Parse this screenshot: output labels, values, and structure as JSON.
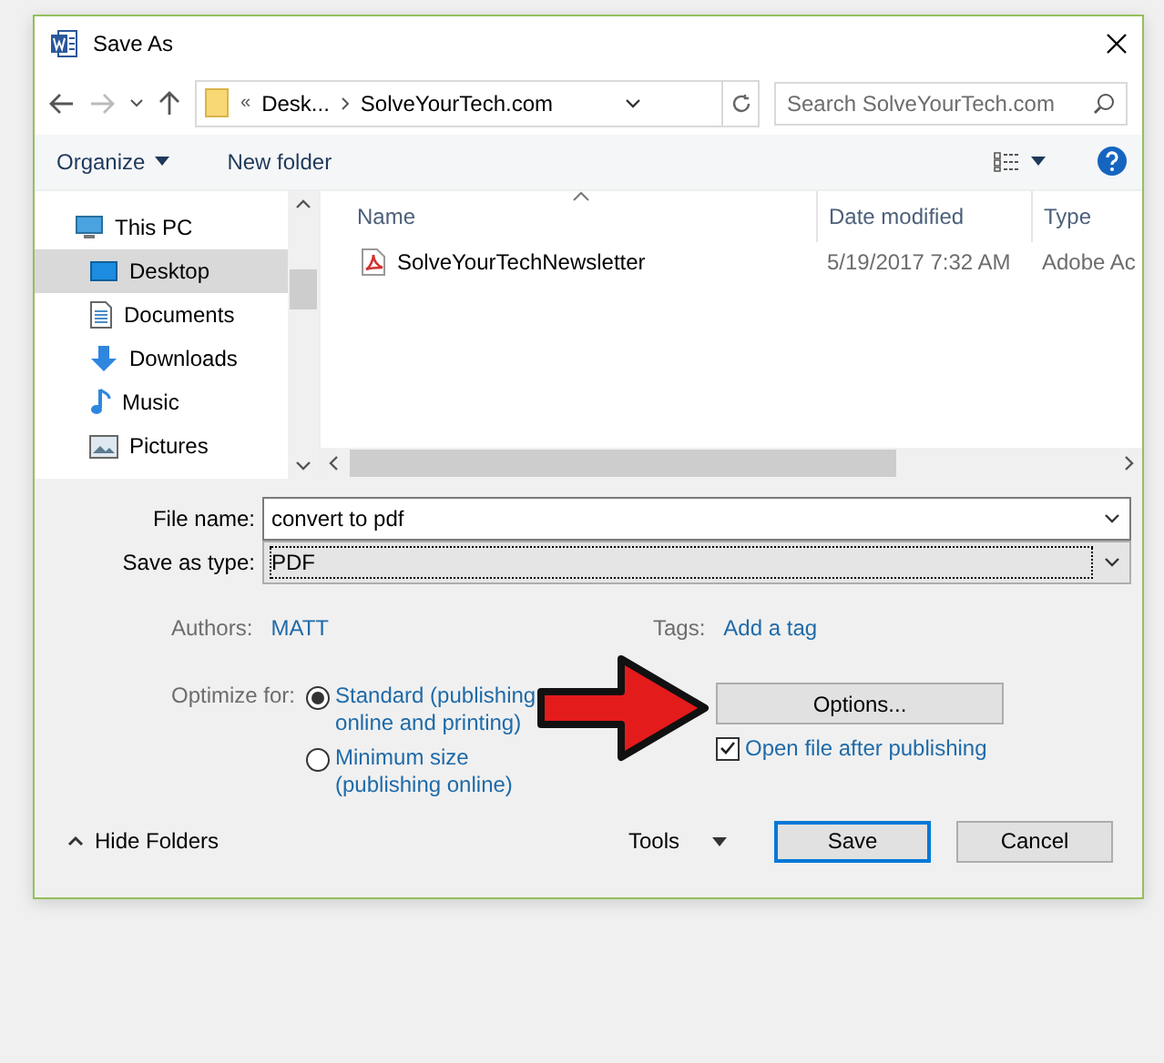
{
  "window": {
    "title": "Save As"
  },
  "address": {
    "overflow": "«",
    "crumbs": [
      "Desk...",
      "SolveYourTech.com"
    ]
  },
  "search": {
    "placeholder": "Search SolveYourTech.com"
  },
  "toolbar": {
    "organize": "Organize",
    "new_folder": "New folder"
  },
  "nav_tree": [
    {
      "label": "This PC",
      "selected": false,
      "children": [
        {
          "label": "Desktop",
          "selected": true
        },
        {
          "label": "Documents",
          "selected": false
        },
        {
          "label": "Downloads",
          "selected": false
        },
        {
          "label": "Music",
          "selected": false
        },
        {
          "label": "Pictures",
          "selected": false
        }
      ]
    }
  ],
  "columns": [
    "Name",
    "Date modified",
    "Type"
  ],
  "files": [
    {
      "name": "SolveYourTechNewsletter",
      "date": "5/19/2017 7:32 AM",
      "type": "Adobe Ac"
    }
  ],
  "file_name": {
    "label": "File name:",
    "value": "convert to pdf"
  },
  "save_type": {
    "label": "Save as type:",
    "value": "PDF"
  },
  "authors": {
    "label": "Authors:",
    "value": "MATT"
  },
  "tags": {
    "label": "Tags:",
    "value": "Add a tag"
  },
  "optimize": {
    "label": "Optimize for:",
    "options": [
      {
        "label": "Standard (publishing online and printing)",
        "selected": true
      },
      {
        "label": "Minimum size (publishing online)",
        "selected": false
      }
    ]
  },
  "options_button": "Options...",
  "open_after": {
    "label": "Open file after publishing",
    "checked": true
  },
  "footer": {
    "hide_folders": "Hide Folders",
    "tools": "Tools",
    "save": "Save",
    "cancel": "Cancel"
  }
}
